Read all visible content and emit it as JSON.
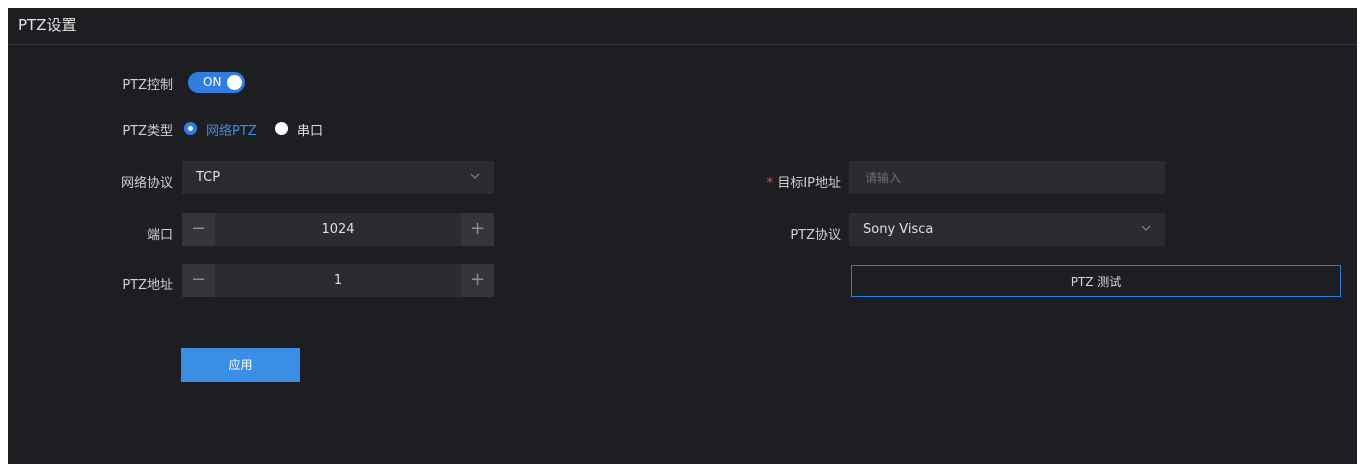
{
  "panel": {
    "title": "PTZ设置"
  },
  "ptz_control": {
    "label": "PTZ控制",
    "toggle_text": "ON",
    "enabled": true
  },
  "ptz_type": {
    "label": "PTZ类型",
    "options": [
      {
        "label": "网络PTZ",
        "selected": true
      },
      {
        "label": "串口",
        "selected": false
      }
    ]
  },
  "network_protocol": {
    "label": "网络协议",
    "value": "TCP"
  },
  "port": {
    "label": "端口",
    "value": "1024"
  },
  "ptz_address": {
    "label": "PTZ地址",
    "value": "1"
  },
  "target_ip": {
    "required_mark": "*",
    "label": "目标IP地址",
    "placeholder": "请输入",
    "value": ""
  },
  "ptz_protocol": {
    "label": "PTZ协议",
    "value": "Sony Visca"
  },
  "buttons": {
    "ptz_test": "PTZ 测试",
    "apply": "应用",
    "minus": "−",
    "plus": "+"
  },
  "colors": {
    "accent": "#2f7de1",
    "panel_bg": "#1d1e22",
    "field_bg": "#2b2c31",
    "required": "#e05353"
  }
}
